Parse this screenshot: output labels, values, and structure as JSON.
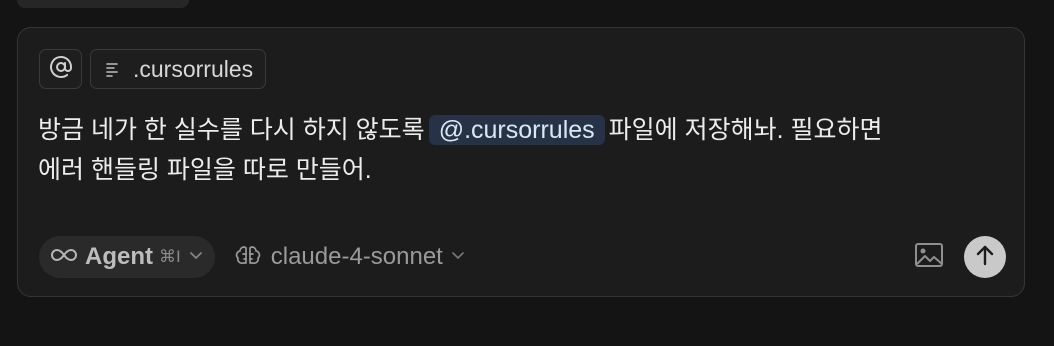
{
  "context": {
    "file_chip_label": ".cursorrules"
  },
  "message": {
    "line1_before": "방금 네가 한 실수를 다시 하지 않도록",
    "mention": "@.cursorrules",
    "line1_after": "파일에 저장해놔. 필요하면",
    "line2": "에러 핸들링 파일을 따로 만들어."
  },
  "footer": {
    "mode_label": "Agent",
    "mode_shortcut": "⌘I",
    "model_name": "claude-4-sonnet"
  },
  "colors": {
    "background": "#141414",
    "composer": "#1c1c1c",
    "mention_bg": "#263245",
    "send_button": "#c9c9c9"
  }
}
